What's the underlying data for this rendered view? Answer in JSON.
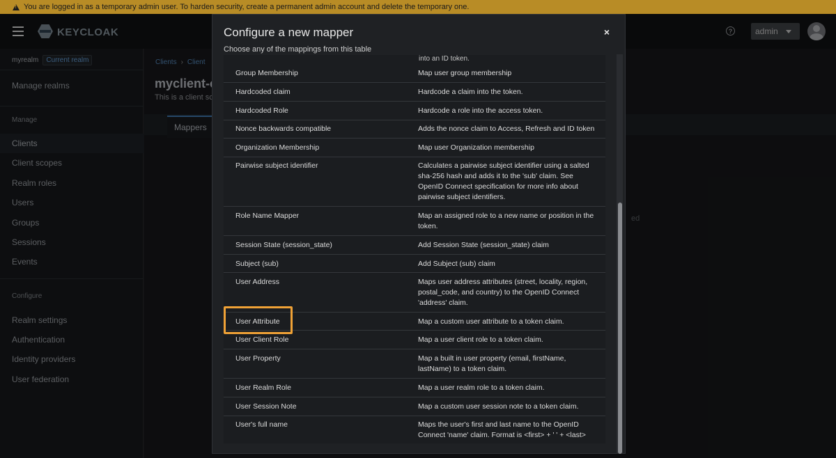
{
  "banner": {
    "text": "You are logged in as a temporary admin user. To harden security, create a permanent admin account and delete the temporary one."
  },
  "header": {
    "logo_text": "KEYCLOAK",
    "user": "admin",
    "help": "?"
  },
  "sidebar": {
    "realm": "myrealm",
    "realm_badge": "Current realm",
    "manage_realms": "Manage realms",
    "manage_heading": "Manage",
    "manage_items": [
      "Clients",
      "Client scopes",
      "Realm roles",
      "Users",
      "Groups",
      "Sessions",
      "Events"
    ],
    "configure_heading": "Configure",
    "configure_items": [
      "Realm settings",
      "Authentication",
      "Identity providers",
      "User federation"
    ]
  },
  "main": {
    "breadcrumb": [
      "Clients",
      "Client"
    ],
    "title": "myclient-c",
    "subtitle": "This is a client sc",
    "tab": "Mappers",
    "faded_text": "ed"
  },
  "modal": {
    "title": "Configure a new mapper",
    "description": "Choose any of the mappings from this table",
    "close": "×",
    "clipped_top_text": "into an ID token.",
    "rows": [
      {
        "name": "Group Membership",
        "desc": "Map user group membership"
      },
      {
        "name": "Hardcoded claim",
        "desc": "Hardcode a claim into the token."
      },
      {
        "name": "Hardcoded Role",
        "desc": "Hardcode a role into the access token."
      },
      {
        "name": "Nonce backwards compatible",
        "desc": "Adds the nonce claim to Access, Refresh and ID token"
      },
      {
        "name": "Organization Membership",
        "desc": "Map user Organization membership"
      },
      {
        "name": "Pairwise subject identifier",
        "desc": "Calculates a pairwise subject identifier using a salted sha-256 hash and adds it to the 'sub' claim. See OpenID Connect specification for more info about pairwise subject identifiers."
      },
      {
        "name": "Role Name Mapper",
        "desc": "Map an assigned role to a new name or position in the token."
      },
      {
        "name": "Session State (session_state)",
        "desc": "Add Session State (session_state) claim"
      },
      {
        "name": "Subject (sub)",
        "desc": "Add Subject (sub) claim"
      },
      {
        "name": "User Address",
        "desc": "Maps user address attributes (street, locality, region, postal_code, and country) to the OpenID Connect 'address' claim."
      },
      {
        "name": "User Attribute",
        "desc": "Map a custom user attribute to a token claim."
      },
      {
        "name": "User Client Role",
        "desc": "Map a user client role to a token claim."
      },
      {
        "name": "User Property",
        "desc": "Map a built in user property (email, firstName, lastName) to a token claim."
      },
      {
        "name": "User Realm Role",
        "desc": "Map a user realm role to a token claim."
      },
      {
        "name": "User Session Note",
        "desc": "Map a custom user session note to a token claim."
      },
      {
        "name": "User's full name",
        "desc": "Maps the user's first and last name to the OpenID Connect 'name' claim. Format is <first> + ' ' + <last>"
      }
    ]
  },
  "colors": {
    "highlight": "#f0a236",
    "banner": "#b88c26",
    "link": "#4f7fae"
  }
}
